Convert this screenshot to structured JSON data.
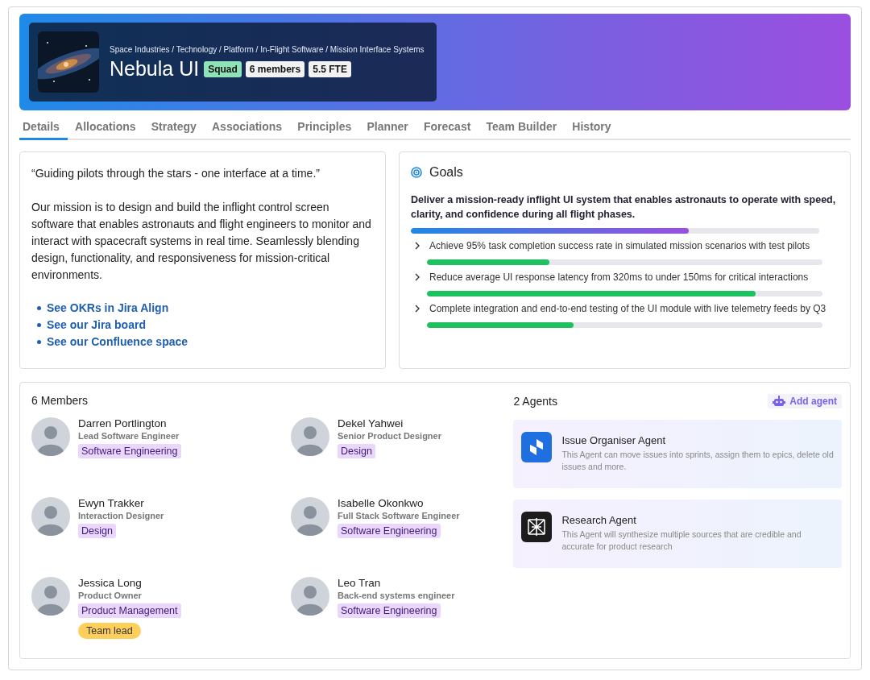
{
  "header": {
    "breadcrumb": "Space Industries / Technology / Platform / In-Flight Software / Mission Interface Systems",
    "title": "Nebula UI",
    "badges": [
      {
        "label": "Squad",
        "kind": "type"
      },
      {
        "label": "6 members",
        "kind": "count"
      },
      {
        "label": "5.5 FTE",
        "kind": "count"
      }
    ]
  },
  "tabs": [
    {
      "label": "Details",
      "selected": true
    },
    {
      "label": "Allocations",
      "selected": false
    },
    {
      "label": "Strategy",
      "selected": false
    },
    {
      "label": "Associations",
      "selected": false
    },
    {
      "label": "Principles",
      "selected": false
    },
    {
      "label": "Planner",
      "selected": false
    },
    {
      "label": "Forecast",
      "selected": false
    },
    {
      "label": "Team Builder",
      "selected": false
    },
    {
      "label": "History",
      "selected": false
    }
  ],
  "mission": {
    "quote": "“Guiding pilots through the stars - one interface at a time.”",
    "text": "Our mission is to design and build the inflight control screen software that enables astronauts and flight engineers to monitor and interact with spacecraft systems in real time. Seamlessly blending design, functionality, and responsiveness for mission-critical environments.",
    "links": [
      "See OKRs in Jira Align",
      "See our Jira board",
      "See our Confluence space"
    ]
  },
  "goals": {
    "title": "Goals",
    "objective": "Deliver a mission-ready inflight UI system that enables astronauts to operate with speed, clarity, and confidence during all flight phases.",
    "level": 0.68,
    "key_results": [
      {
        "text": "Achieve 95% task completion success rate in simulated mission scenarios with test pilots",
        "level": 0.31,
        "expanded": false
      },
      {
        "text": "Reduce average UI response latency from 320ms to under 150ms for critical interactions",
        "level": 0.83,
        "expanded": false
      },
      {
        "text": "Complete integration and end-to-end testing of the UI module with live telemetry feeds by Q3",
        "level": 0.37,
        "expanded": false
      }
    ]
  },
  "members": {
    "title": "6 Members",
    "items": [
      {
        "name": "Darren Portlington",
        "role": "Lead Software Engineer",
        "discipline": "Software Engineering"
      },
      {
        "name": "Dekel Yahwei",
        "role": "Senior Product Designer",
        "discipline": "Design"
      },
      {
        "name": "Ewyn Trakker",
        "role": "Interaction Designer",
        "discipline": "Design"
      },
      {
        "name": "Isabelle Okonkwo",
        "role": "Full Stack Software Engineer",
        "discipline": "Software Engineering"
      },
      {
        "name": "Jessica Long",
        "role": "Product Owner",
        "discipline": "Product Management",
        "lead_badge": "Team lead"
      },
      {
        "name": "Leo Tran",
        "role": "Back-end systems engineer",
        "discipline": "Software Engineering"
      }
    ]
  },
  "agents": {
    "title": "2 Agents",
    "add_button": "Add agent",
    "items": [
      {
        "name": "Issue Organiser Agent",
        "description": "This Agent can move issues into sprints, assign them to epics, delete old issues and more.",
        "kind": "organiser"
      },
      {
        "name": "Research Agent",
        "description": "This Agent will synthesize multiple  sources that are credible and accurate for product research",
        "kind": "research"
      }
    ]
  }
}
